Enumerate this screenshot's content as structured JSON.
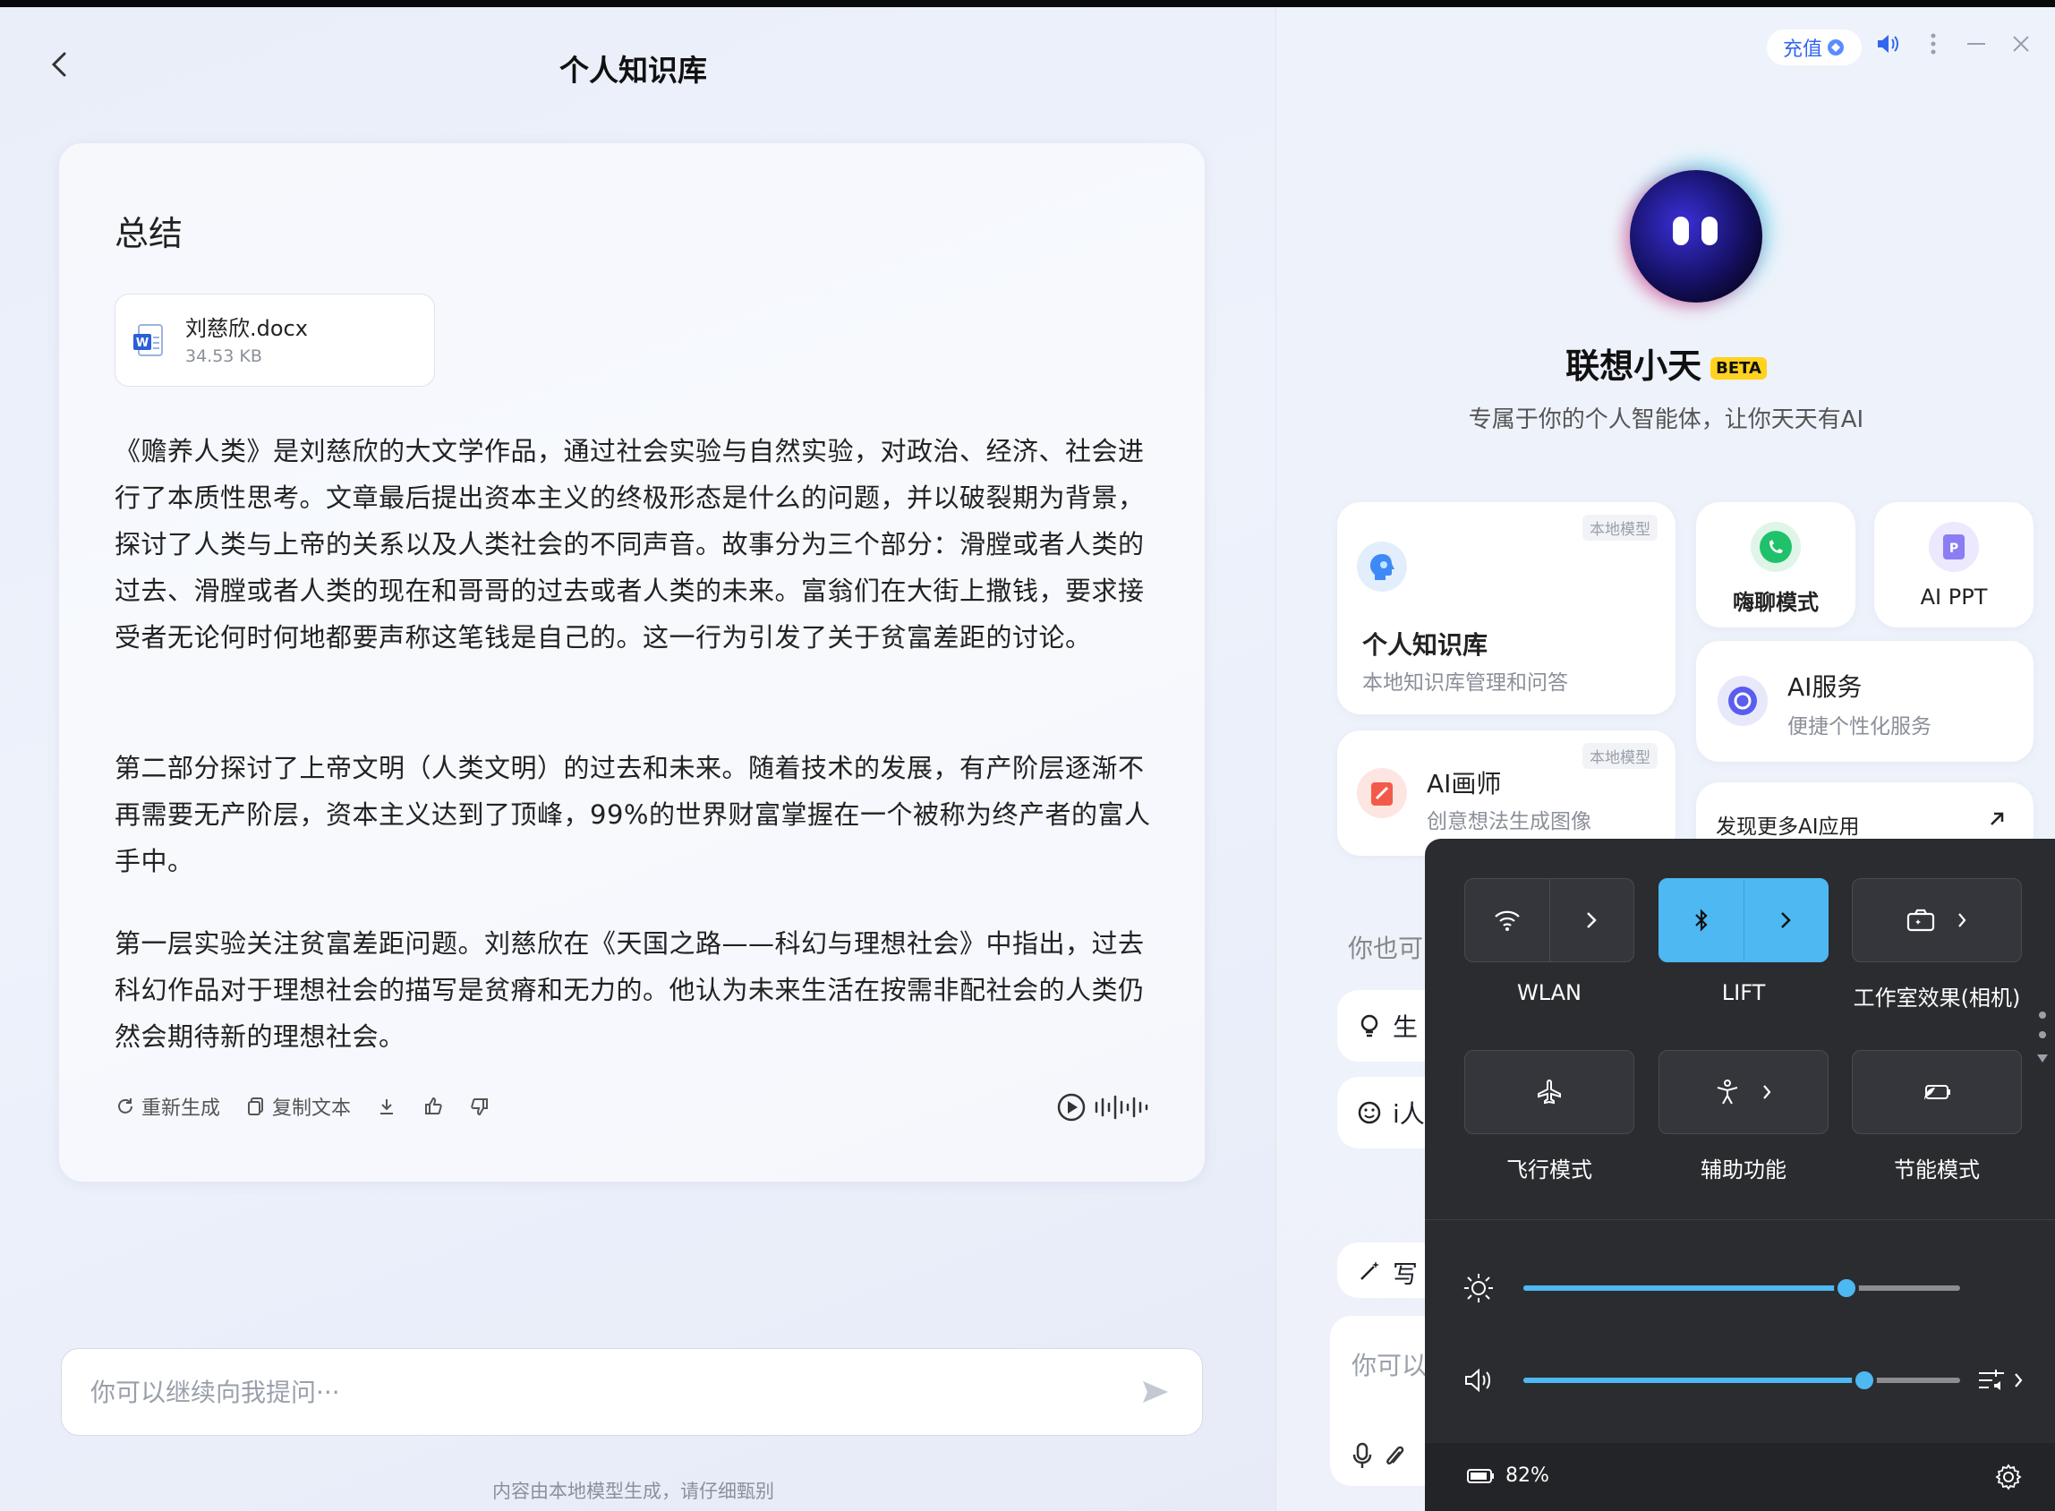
{
  "header": {
    "back_icon": "chevron-left-icon",
    "title": "个人知识库"
  },
  "card": {
    "heading": "总结",
    "file": {
      "name": "刘慈欣.docx",
      "size": "34.53 KB",
      "icon": "word-file-icon"
    },
    "paragraphs": [
      "《赡养人类》是刘慈欣的大文学作品，通过社会实验与自然实验，对政治、经济、社会进行了本质性思考。文章最后提出资本主义的终极形态是什么的问题，并以破裂期为背景，探讨了人类与上帝的关系以及人类社会的不同声音。故事分为三个部分：滑膛或者人类的过去、滑膛或者人类的现在和哥哥的过去或者人类的未来。富翁们在大街上撒钱，要求接受者无论何时何地都要声称这笔钱是自己的。这一行为引发了关于贫富差距的讨论。",
      "第二部分探讨了上帝文明（人类文明）的过去和未来。随着技术的发展，有产阶层逐渐不再需要无产阶层，资本主义达到了顶峰，99%的世界财富掌握在一个被称为终产者的富人手中。",
      "第一层实验关注贫富差距问题。刘慈欣在《天国之路——科幻与理想社会》中指出，过去科幻作品对于理想社会的描写是贫瘠和无力的。他认为未来生活在按需非配社会的人类仍然会期待新的理想社会。"
    ],
    "actions": {
      "regenerate": "重新生成",
      "copy": "复制文本"
    }
  },
  "input": {
    "placeholder": "你可以继续向我提问···"
  },
  "disclaimer": "内容由本地模型生成，请仔细甄别",
  "assistant": {
    "recharge": "充值",
    "name": "联想小天",
    "badge": "BETA",
    "subtitle": "专属于你的个人智能体，让你天天有AI",
    "tiles": {
      "kb": {
        "tag": "本地模型",
        "title": "个人知识库",
        "sub": "本地知识库管理和问答"
      },
      "chat": {
        "title": "嗨聊模式"
      },
      "ppt": {
        "title": "AI PPT"
      },
      "service": {
        "title": "AI服务",
        "sub": "便捷个性化服务"
      },
      "painter": {
        "tag": "本地模型",
        "title": "AI画师",
        "sub": "创意想法生成图像"
      },
      "discover": {
        "title": "发现更多AI应用"
      }
    },
    "partials": {
      "also": "你也可",
      "item1": "生",
      "item2": "i人",
      "item3": "写",
      "ask": "你可以"
    }
  },
  "quick_settings": {
    "wlan": "WLAN",
    "bluetooth": "LIFT",
    "studio": "工作室效果(相机)",
    "airplane": "飞行模式",
    "accessibility": "辅助功能",
    "battery_saver": "节能模式",
    "brightness": 0.74,
    "volume": 0.78,
    "battery": "82%"
  },
  "colors": {
    "accent": "#4db8f2",
    "brand": "#3266ee",
    "panel": "#2b2c30"
  }
}
